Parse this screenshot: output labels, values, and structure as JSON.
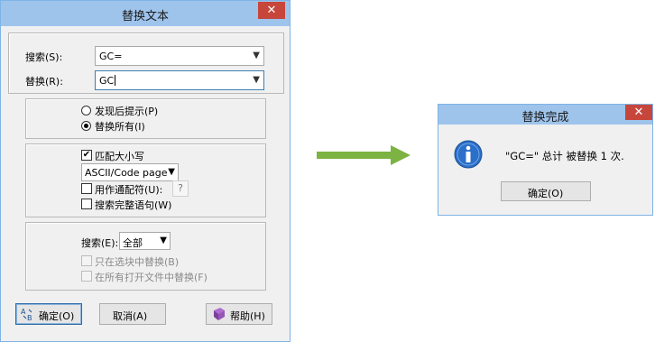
{
  "main_dialog": {
    "title": "替换文本",
    "close_glyph": "✕",
    "search": {
      "label": "搜索(S):",
      "value": "GC="
    },
    "replace": {
      "label": "替换(R):",
      "value": "GC"
    },
    "mode": [
      {
        "label": "发现后提示(P)",
        "selected": false
      },
      {
        "label": "替换所有(I)",
        "selected": true
      }
    ],
    "options": {
      "match_case": {
        "label": "匹配大小写",
        "checked": true
      },
      "encoding": {
        "value": "ASCII/Code page"
      },
      "wildcards": {
        "label": "用作通配符(U):",
        "checked": false,
        "help_glyph": "?"
      },
      "whole_words": {
        "label": "搜索完整语句(W)",
        "checked": false
      }
    },
    "scope": {
      "label": "搜索(E):",
      "value": "全部",
      "in_selection": {
        "label": "只在选块中替换(B)",
        "checked": false,
        "disabled": true
      },
      "in_all_open": {
        "label": "在所有打开文件中替换(F)",
        "checked": false,
        "disabled": true
      }
    },
    "buttons": {
      "ok": "确定(O)",
      "cancel": "取消(A)",
      "help": "帮助(H)"
    }
  },
  "result_dialog": {
    "title": "替换完成",
    "close_glyph": "✕",
    "message": "\"GC=\" 总计 被替换 1 次.",
    "ok": "确定(O)"
  },
  "icons": {
    "ok": "replace-ok-icon",
    "help": "help-book-icon",
    "info": "info-icon",
    "arrow": "right-arrow-icon"
  },
  "colors": {
    "titlebar": "#9ec4ec",
    "close": "#c7463b",
    "arrow": "#7cb342",
    "info": "#2a6fc9"
  }
}
